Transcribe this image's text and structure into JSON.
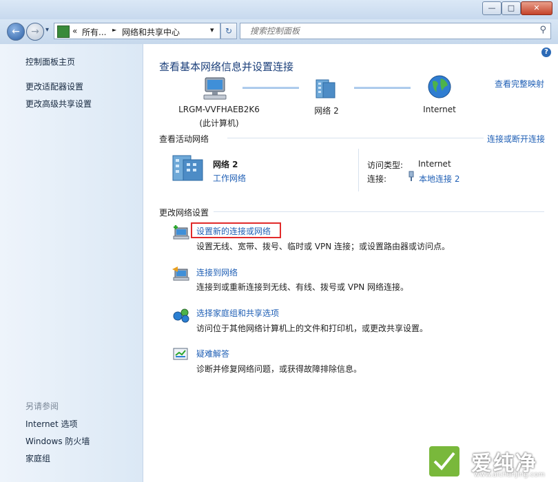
{
  "window": {
    "minimize": "—",
    "maximize": "□",
    "close": "✕"
  },
  "nav": {
    "back_glyph": "←",
    "forward_glyph": "→",
    "breadcrumb_root": "«",
    "breadcrumb_1": "所有...",
    "breadcrumb_sep": "►",
    "breadcrumb_2": "网络和共享中心",
    "dropdown_glyph": "▾",
    "refresh_glyph": "↻",
    "search_placeholder": "搜索控制面板",
    "search_glyph": "⚲"
  },
  "sidebar": {
    "items": [
      {
        "label": "控制面板主页"
      },
      {
        "label": "更改适配器设置"
      },
      {
        "label": "更改高级共享设置"
      }
    ],
    "see_also_title": "另请参阅",
    "see_also": [
      {
        "label": "Internet 选项"
      },
      {
        "label": "Windows 防火墙"
      },
      {
        "label": "家庭组"
      }
    ]
  },
  "main": {
    "help_glyph": "?",
    "title": "查看基本网络信息并设置连接",
    "full_map_link": "查看完整映射",
    "map": {
      "computer_name": "LRGM-VVFHAEB2K6",
      "computer_sub": "(此计算机)",
      "network_name": "网络  2",
      "internet_name": "Internet"
    },
    "active": {
      "section_title": "查看活动网络",
      "connect_link": "连接或断开连接",
      "network_name": "网络  2",
      "network_type": "工作网络",
      "access_type_label": "访问类型:",
      "access_type_value": "Internet",
      "connection_label": "连接:",
      "connection_value": "本地连接 2"
    },
    "settings": {
      "section_title": "更改网络设置",
      "tasks": [
        {
          "title": "设置新的连接或网络",
          "desc": "设置无线、宽带、拨号、临时或 VPN 连接；或设置路由器或访问点。"
        },
        {
          "title": "连接到网络",
          "desc": "连接到或重新连接到无线、有线、拨号或 VPN 网络连接。"
        },
        {
          "title": "选择家庭组和共享选项",
          "desc": "访问位于其他网络计算机上的文件和打印机，或更改共享设置。"
        },
        {
          "title": "疑难解答",
          "desc": "诊断并修复网络问题，或获得故障排除信息。"
        }
      ]
    }
  },
  "watermark": {
    "brand": "爱纯净",
    "url": "www.aichunjing.com"
  },
  "colors": {
    "link": "#1f5fb5",
    "title": "#1b3f7a",
    "highlight_box": "#e12a2a"
  }
}
